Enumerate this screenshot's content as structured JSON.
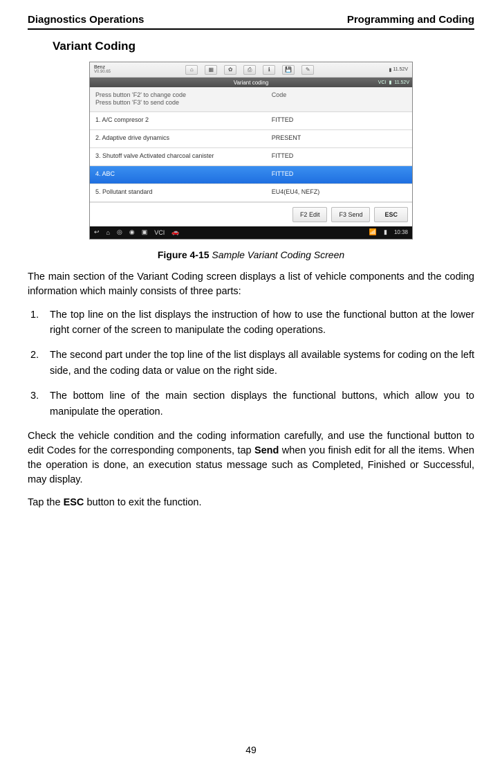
{
  "header": {
    "left": "Diagnostics Operations",
    "right": "Programming and Coding"
  },
  "section_title": "Variant Coding",
  "screenshot": {
    "brand_name": "Benz",
    "brand_ver": "V0.90.65",
    "battery": "11.52V",
    "vci": "VCI",
    "title": "Variant coding",
    "head_left_l1": "Press button 'F2' to change code",
    "head_left_l2": "Press button 'F3' to send code",
    "head_right": "Code",
    "rows": [
      {
        "left": "1. A/C compresor 2",
        "right": "FITTED"
      },
      {
        "left": "2. Adaptive drive dynamics",
        "right": "PRESENT"
      },
      {
        "left": "3. Shutoff valve Activated charcoal canister",
        "right": "FITTED"
      },
      {
        "left": "4. ABC",
        "right": "FITTED"
      },
      {
        "left": "5. Pollutant standard",
        "right": "EU4(EU4, NEFZ)"
      }
    ],
    "btn_f2": "F2 Edit",
    "btn_f3": "F3 Send",
    "btn_esc": "ESC",
    "clock": "10:38"
  },
  "caption_label": "Figure 4-15",
  "caption_text": " Sample Variant Coding Screen",
  "para_intro": "The main section of the Variant Coding screen displays a list of vehicle components and the coding information which mainly consists of three parts:",
  "list": {
    "i1": "The top line on the list displays the instruction of how to use the functional button at the lower right corner of the screen to manipulate the coding operations.",
    "i2": "The second part under the top line of the list displays all available systems for coding on the left side, and the coding data or value on the right side.",
    "i3": "The bottom line of the main section displays the functional buttons, which allow you to manipulate the operation."
  },
  "para_check_a": "Check the vehicle condition and the coding information carefully, and use the functional button to edit Codes for the corresponding components, tap ",
  "para_check_send": "Send",
  "para_check_b": " when you finish edit for all the items. When the operation is done, an execution status message such as Completed, Finished or Successful, may display.",
  "para_tap_a": "Tap the ",
  "para_tap_esc": "ESC",
  "para_tap_b": " button to exit the function.",
  "page_number": "49"
}
